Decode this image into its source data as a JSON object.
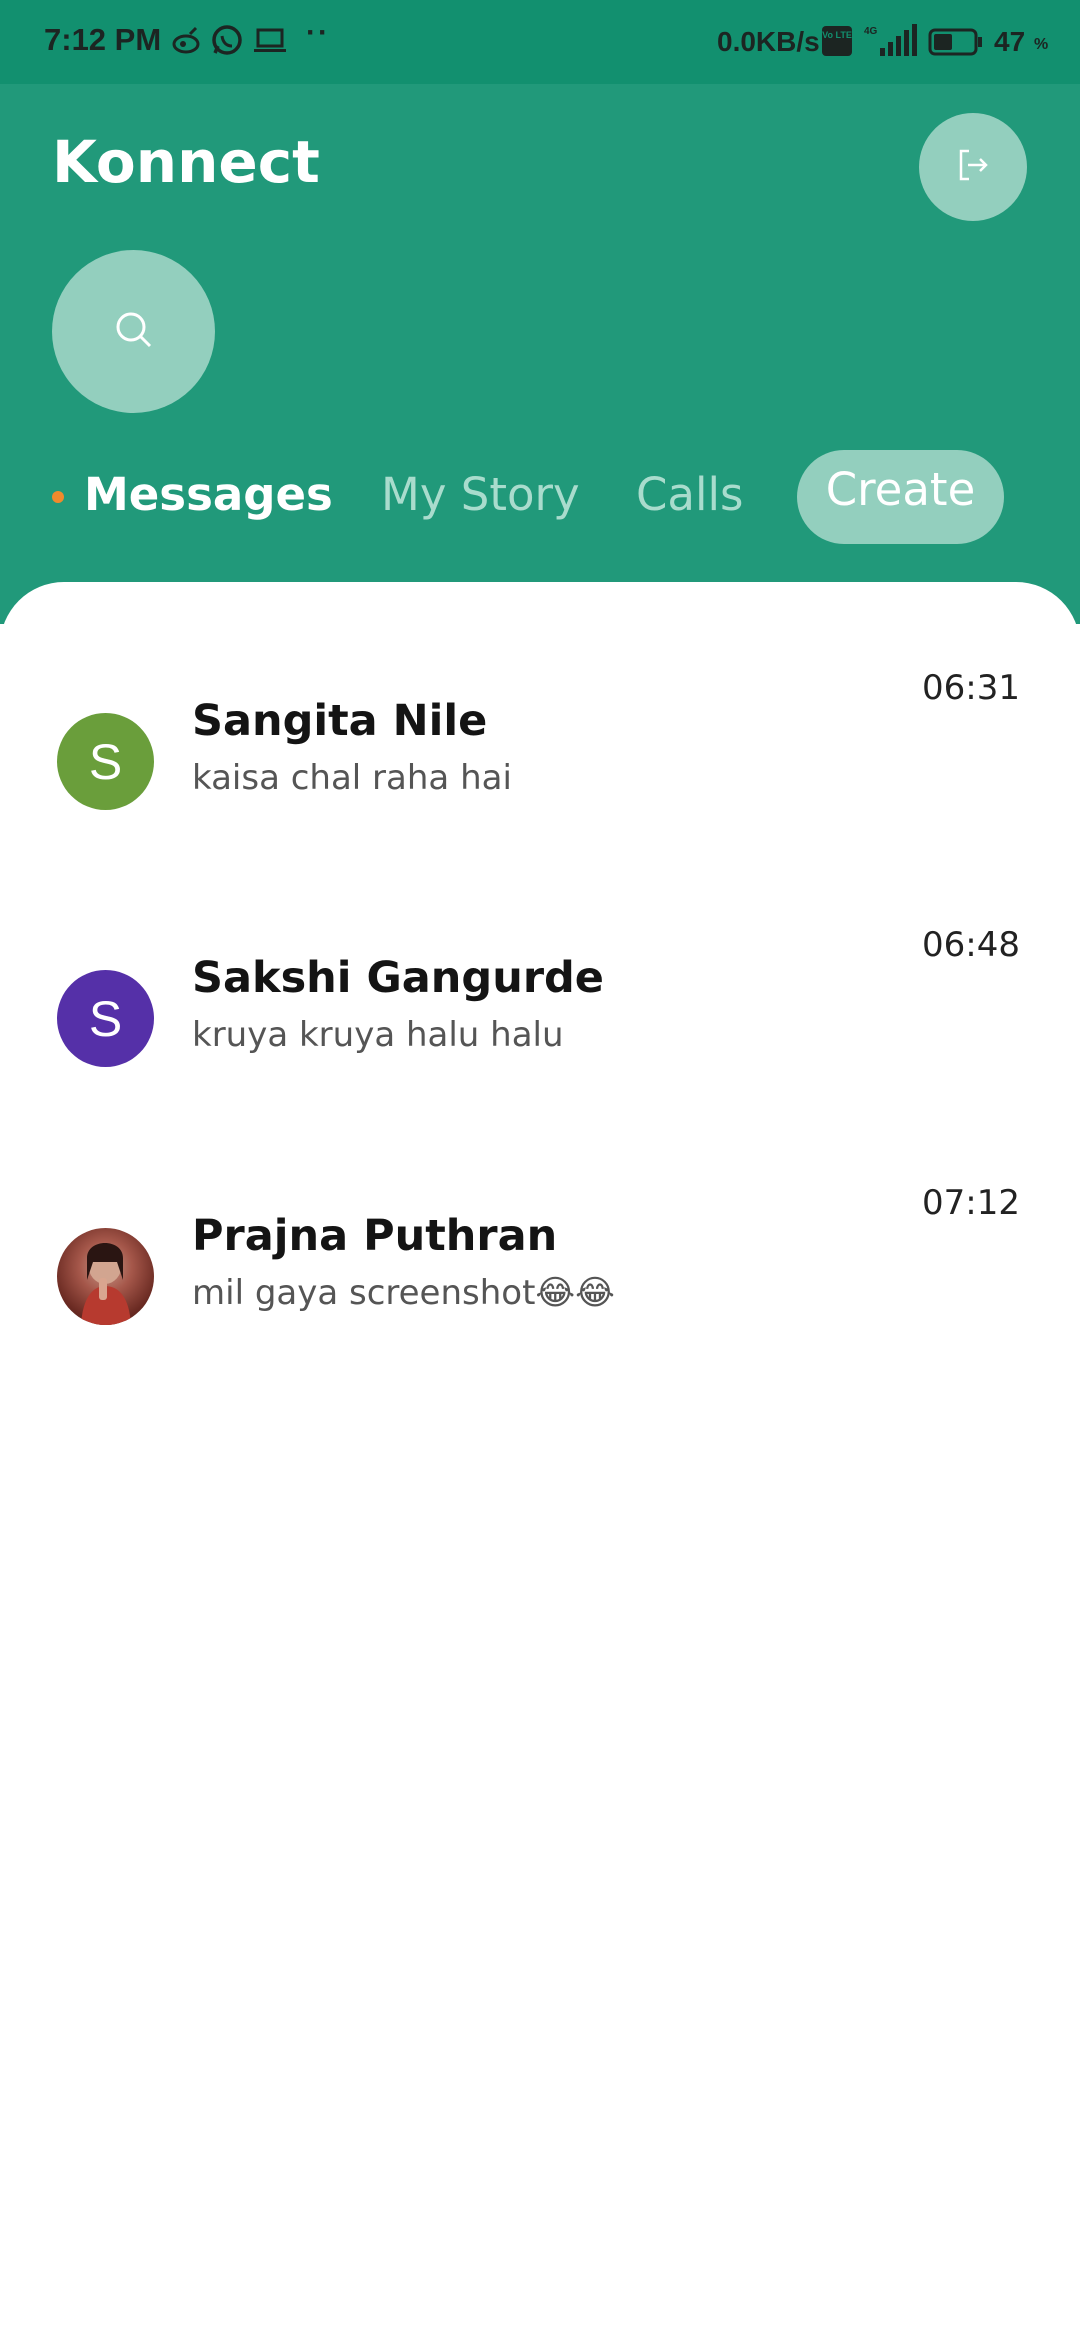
{
  "status_bar": {
    "time": "7:12 PM",
    "more": "··",
    "network_speed": "0.0KB/s",
    "volte": "Vo LTE",
    "network_type": "4G",
    "battery_level": "47",
    "battery_unit": "%",
    "battery_fraction": 0.47
  },
  "header": {
    "app_title": "Konnect",
    "logout_icon": "logout-icon",
    "search_icon": "search-icon"
  },
  "tabs": [
    {
      "label": "Messages",
      "active": true
    },
    {
      "label": "My Story",
      "active": false
    },
    {
      "label": "Calls",
      "active": false
    },
    {
      "label": "Create",
      "active": false
    }
  ],
  "chats": [
    {
      "initial": "S",
      "name": "Sangita Nile",
      "message": "kaisa chal raha hai",
      "time": "06:31",
      "avatar_color": "#6a9e3b"
    },
    {
      "initial": "S",
      "name": "Sakshi Gangurde",
      "message": "kruya kruya halu halu",
      "time": "06:48",
      "avatar_color": "#5530a8"
    },
    {
      "initial": "",
      "name": "Prajna Puthran",
      "message": "mil gaya screenshot😂😂",
      "time": "07:12",
      "avatar_color": "#8a3a30"
    }
  ],
  "colors": {
    "header_bg": "#21997a",
    "status_bg": "#12906f",
    "accent_light": "#93cfbe",
    "active_dot": "#f08a2c"
  }
}
